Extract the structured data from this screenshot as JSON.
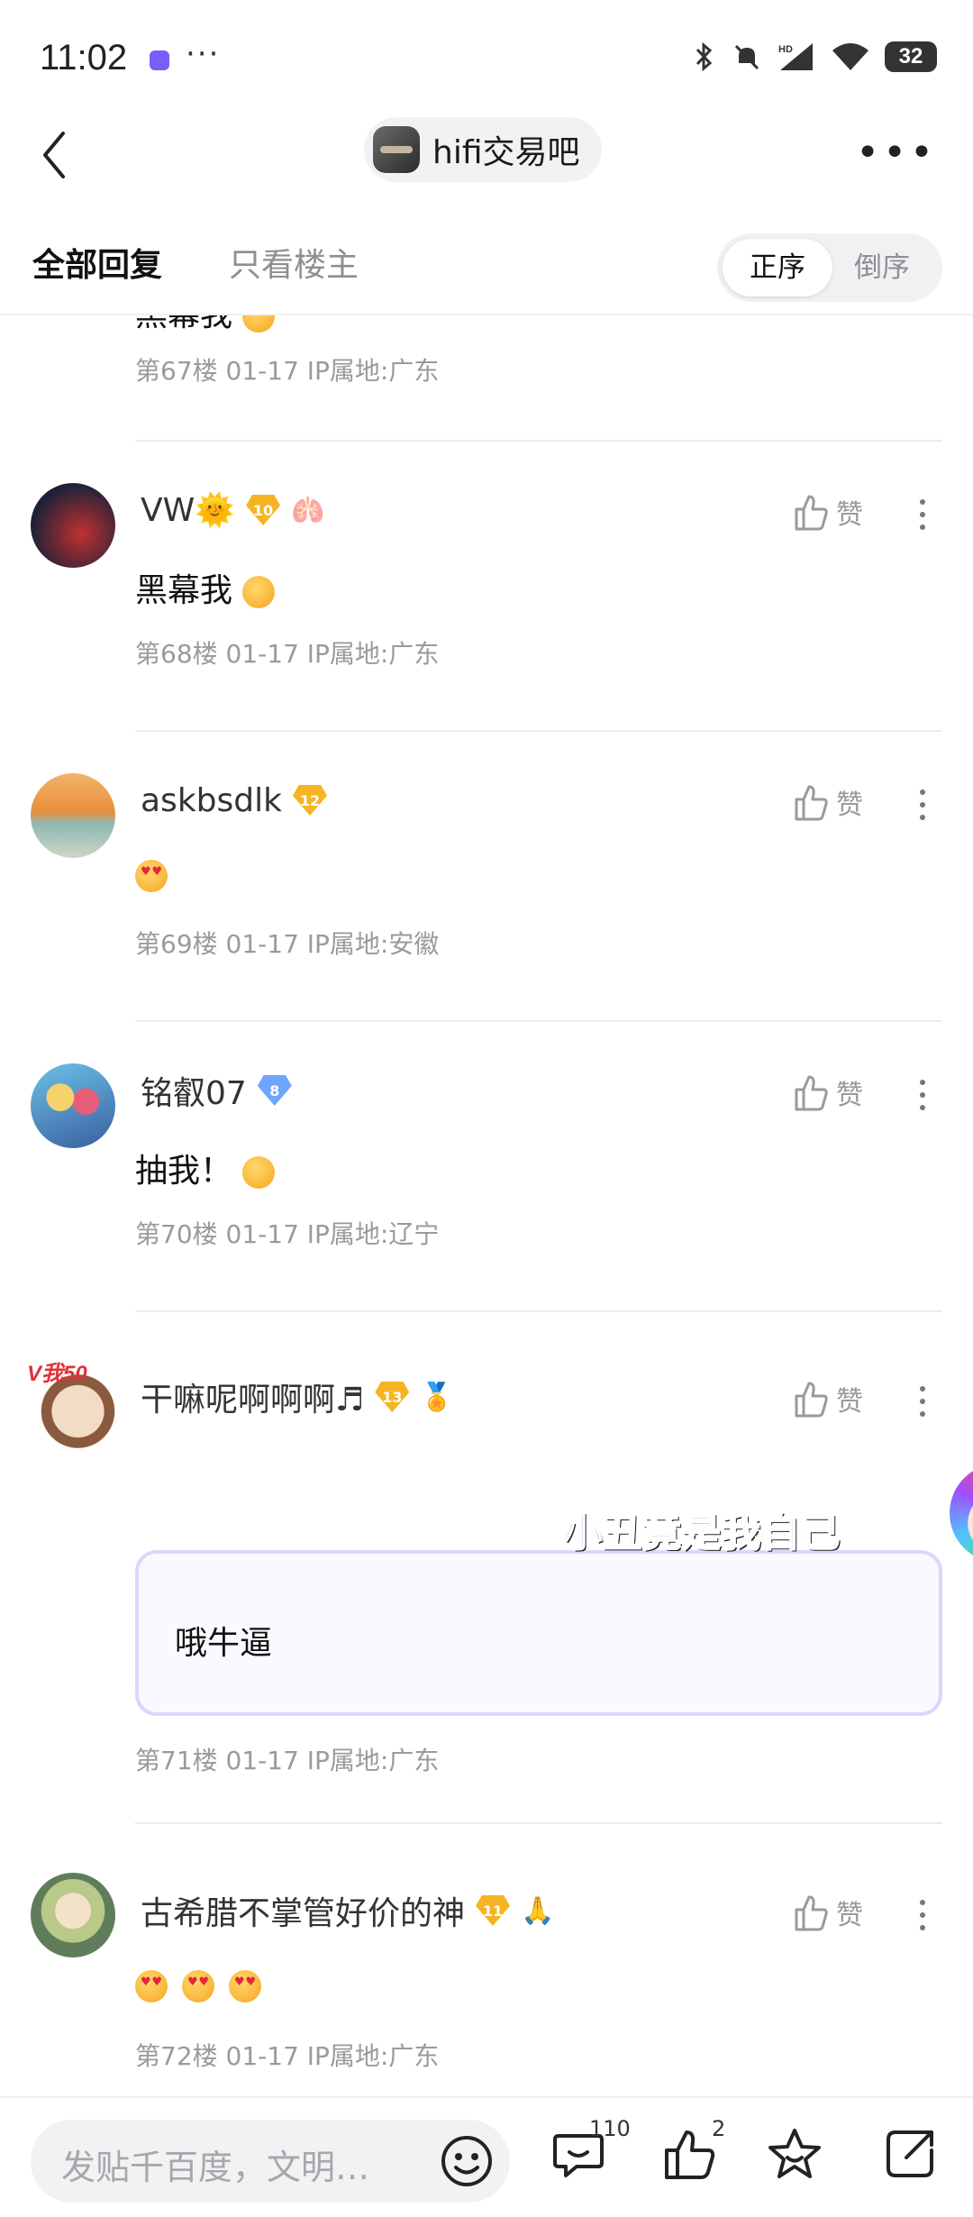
{
  "status_bar": {
    "time": "11:02",
    "battery": "32"
  },
  "nav": {
    "forum_name": "hifi交易吧"
  },
  "tabs": {
    "all_replies": "全部回复",
    "op_only": "只看楼主",
    "order_asc": "正序",
    "order_desc": "倒序"
  },
  "posts": [
    {
      "username": "",
      "content": "黑幕我",
      "meta": "第67楼   01-17   IP属地:广东"
    },
    {
      "username": "VW🌞",
      "level": "10",
      "like_label": "赞",
      "content": "黑幕我",
      "meta": "第68楼   01-17   IP属地:广东"
    },
    {
      "username": "askbsdlk",
      "level": "12",
      "like_label": "赞",
      "content": "",
      "meta": "第69楼   01-17   IP属地:安徽"
    },
    {
      "username": "铭叡07",
      "level": "8",
      "like_label": "赞",
      "content": "抽我！",
      "meta": "第70楼   01-17   IP属地:辽宁"
    },
    {
      "username": "干嘛呢啊啊啊♬",
      "avatar_text": "V我50",
      "level": "13",
      "like_label": "赞",
      "sticker_text": "小丑竟是我自己",
      "content": "哦牛逼",
      "meta": "第71楼   01-17   IP属地:广东"
    },
    {
      "username": "古希腊不掌管好价的神",
      "level": "11",
      "like_label": "赞",
      "content": "",
      "meta": "第72楼   01-17   IP属地:广东"
    }
  ],
  "bottom_bar": {
    "placeholder": "发贴千百度，文明…",
    "comment_count": "110",
    "like_count": "2"
  },
  "colors": {
    "accent_purple": "#ddd5ff",
    "level_gold": "#f6b422",
    "level_blue": "#6ea6ff",
    "meta_gray": "#9a9a9e"
  },
  "icons": [
    "back-icon",
    "more-icon",
    "like-icon",
    "menu-dots-icon",
    "emoji-icon",
    "comment-icon",
    "star-icon",
    "share-icon"
  ]
}
